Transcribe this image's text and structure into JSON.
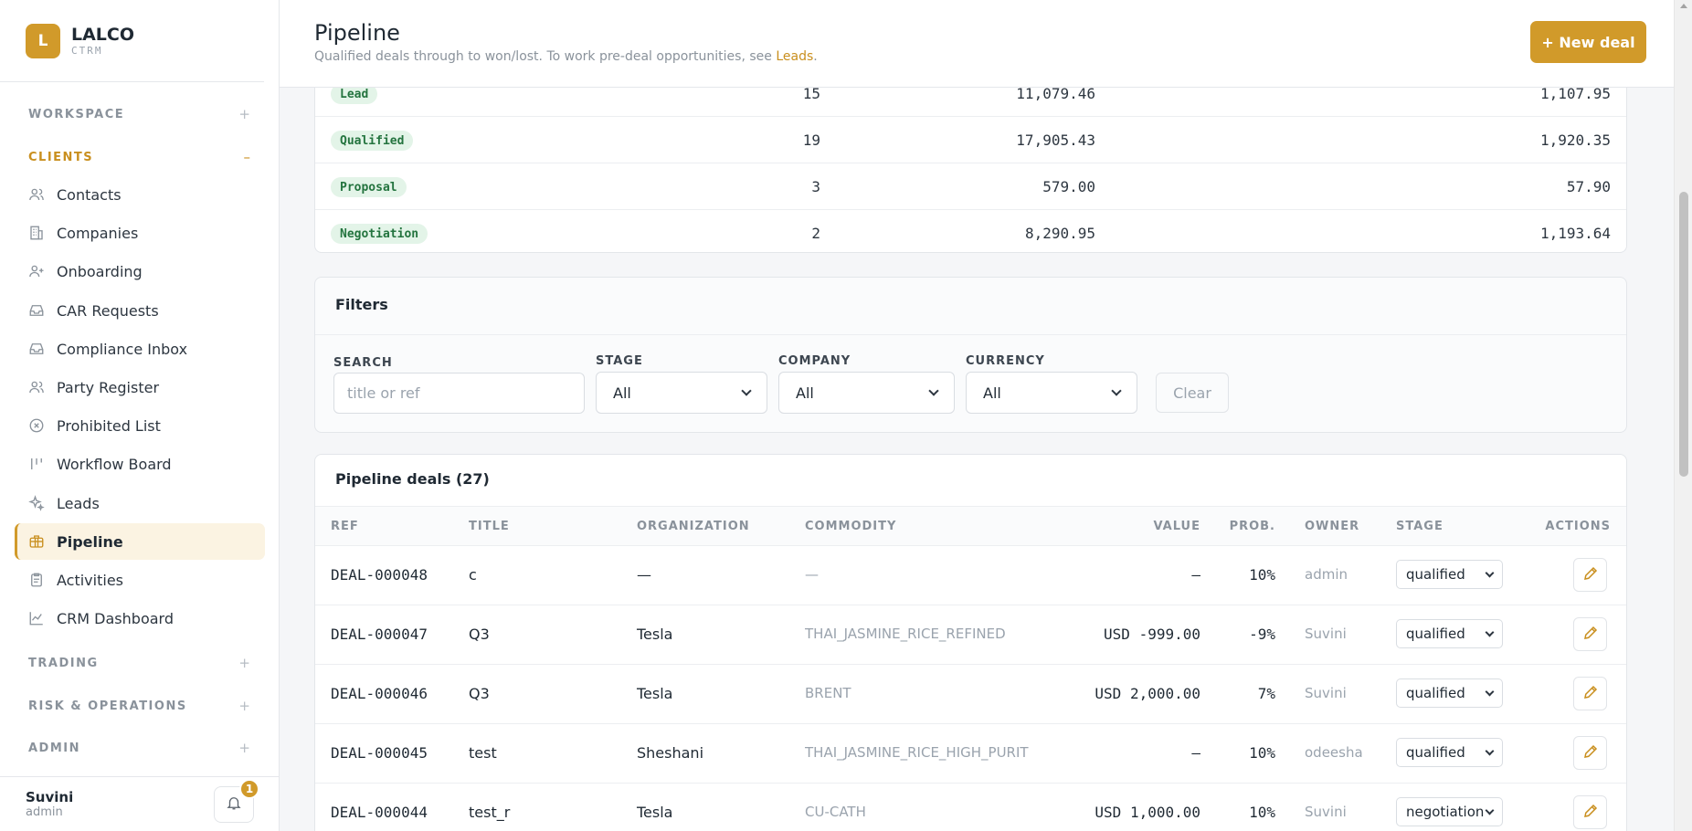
{
  "brand": {
    "logo_letter": "L",
    "name": "LALCO",
    "sub": "CTRM"
  },
  "sidebar": {
    "sections": [
      {
        "label": "WORKSPACE",
        "toggle": "+"
      },
      {
        "label": "CLIENTS",
        "toggle": "–"
      },
      {
        "label": "TRADING",
        "toggle": "+"
      },
      {
        "label": "RISK & OPERATIONS",
        "toggle": "+"
      },
      {
        "label": "ADMIN",
        "toggle": "+"
      }
    ],
    "items": [
      {
        "label": "Contacts",
        "icon": "users-icon"
      },
      {
        "label": "Companies",
        "icon": "building-icon"
      },
      {
        "label": "Onboarding",
        "icon": "user-plus-icon"
      },
      {
        "label": "CAR Requests",
        "icon": "inbox-icon"
      },
      {
        "label": "Compliance Inbox",
        "icon": "inbox-icon"
      },
      {
        "label": "Party Register",
        "icon": "users-icon"
      },
      {
        "label": "Prohibited List",
        "icon": "x-circle-icon"
      },
      {
        "label": "Workflow Board",
        "icon": "kanban-icon"
      },
      {
        "label": "Leads",
        "icon": "sparkles-icon"
      },
      {
        "label": "Pipeline",
        "icon": "briefcase-icon",
        "active": true
      },
      {
        "label": "Activities",
        "icon": "clipboard-icon"
      },
      {
        "label": "CRM Dashboard",
        "icon": "chart-line-icon"
      }
    ]
  },
  "user": {
    "name": "Suvini",
    "role": "admin",
    "notifications": "1"
  },
  "header": {
    "title": "Pipeline",
    "subtitle_prefix": "Qualified deals through to won/lost. To work pre-deal opportunities, see ",
    "subtitle_link": "Leads",
    "subtitle_suffix": ".",
    "new_deal_label": "+ New deal"
  },
  "summary": [
    {
      "stage": "Lead",
      "count": "15",
      "total": "11,079.46",
      "weighted": "1,107.95"
    },
    {
      "stage": "Qualified",
      "count": "19",
      "total": "17,905.43",
      "weighted": "1,920.35"
    },
    {
      "stage": "Proposal",
      "count": "3",
      "total": "579.00",
      "weighted": "57.90"
    },
    {
      "stage": "Negotiation",
      "count": "2",
      "total": "8,290.95",
      "weighted": "1,193.64"
    }
  ],
  "filters": {
    "title": "Filters",
    "search_label": "SEARCH",
    "search_placeholder": "title or ref",
    "stage_label": "STAGE",
    "stage_value": "All",
    "company_label": "COMPANY",
    "company_value": "All",
    "currency_label": "CURRENCY",
    "currency_value": "All",
    "clear_label": "Clear"
  },
  "deals": {
    "title": "Pipeline deals (27)",
    "columns": {
      "ref": "REF",
      "title": "TITLE",
      "org": "ORGANIZATION",
      "commodity": "COMMODITY",
      "value": "VALUE",
      "prob": "PROB.",
      "owner": "OWNER",
      "stage": "STAGE",
      "actions": "ACTIONS"
    },
    "rows": [
      {
        "ref": "DEAL-000048",
        "title": "c",
        "org": "—",
        "commodity": "—",
        "value": "—",
        "prob": "10%",
        "owner": "admin",
        "stage": "qualified"
      },
      {
        "ref": "DEAL-000047",
        "title": "Q3",
        "org": "Tesla",
        "commodity": "THAI_JASMINE_RICE_REFINED",
        "value": "USD -999.00",
        "prob": "-9%",
        "owner": "Suvini",
        "stage": "qualified"
      },
      {
        "ref": "DEAL-000046",
        "title": "Q3",
        "org": "Tesla",
        "commodity": "BRENT",
        "value": "USD 2,000.00",
        "prob": "7%",
        "owner": "Suvini",
        "stage": "qualified"
      },
      {
        "ref": "DEAL-000045",
        "title": "test",
        "org": "Sheshani",
        "commodity": "THAI_JASMINE_RICE_HIGH_PURIT",
        "value": "—",
        "prob": "10%",
        "owner": "odeesha",
        "stage": "qualified"
      },
      {
        "ref": "DEAL-000044",
        "title": "test_r",
        "org": "Tesla",
        "commodity": "CU-CATH",
        "value": "USD 1,000.00",
        "prob": "10%",
        "owner": "Suvini",
        "stage": "negotiation"
      }
    ]
  },
  "colors": {
    "accent": "#d19a2a",
    "pill_bg": "#e3f4e8",
    "pill_text": "#24743f"
  }
}
